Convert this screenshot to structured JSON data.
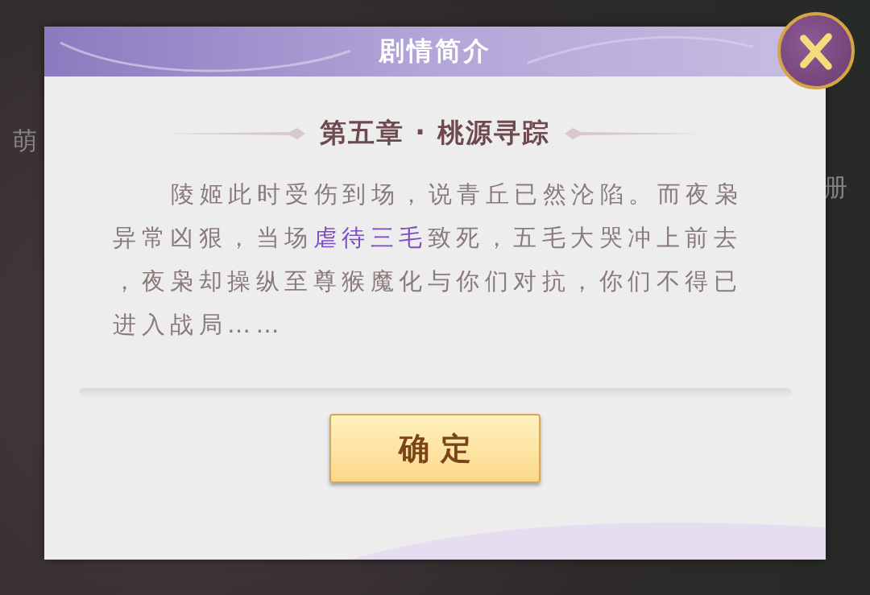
{
  "background": {
    "labels": [
      {
        "text": "萌"
      },
      {
        "text": "册"
      }
    ]
  },
  "dialog": {
    "title": "剧情简介",
    "chapter_title": "第五章 · 桃源寻踪",
    "story_lines": [
      [
        {
          "text": "陵姬此时受伤到场，说青丘已然沦陷。而夜枭",
          "highlight": false
        }
      ],
      [
        {
          "text": "异常凶狠，当场",
          "highlight": false
        },
        {
          "text": "虐待三毛",
          "highlight": true
        },
        {
          "text": "致死，五毛大哭冲上前去",
          "highlight": false
        }
      ],
      [
        {
          "text": "，夜枭却操纵至尊猴魔化与你们对抗，你们不得已",
          "highlight": false
        }
      ],
      [
        {
          "text": "进入战局……",
          "highlight": false
        }
      ]
    ],
    "confirm_button": "确 定"
  }
}
